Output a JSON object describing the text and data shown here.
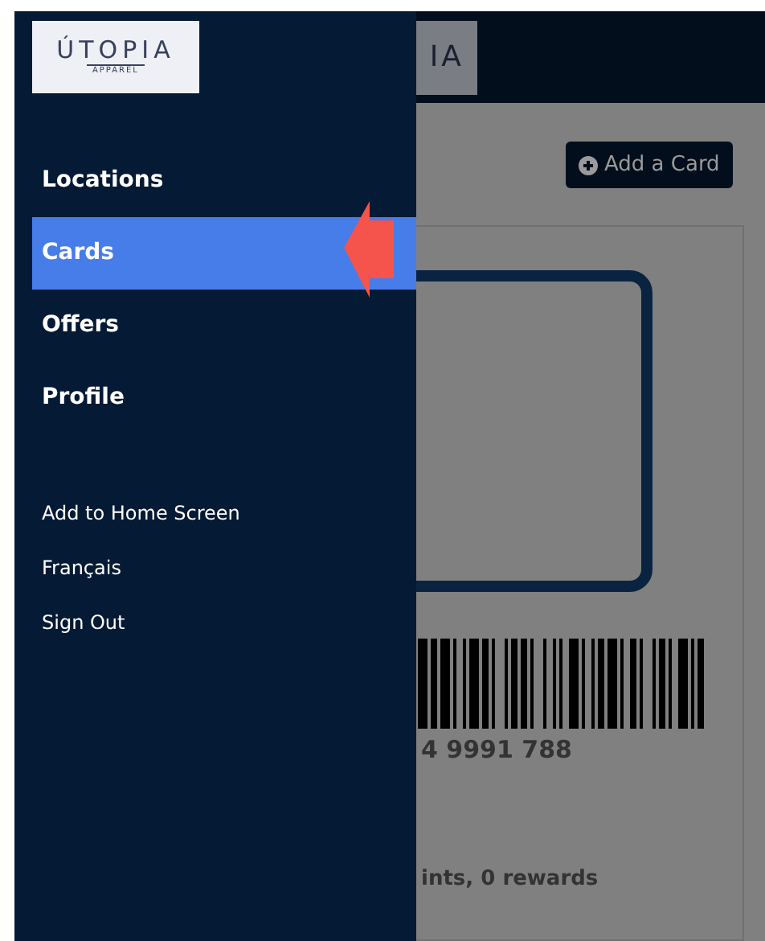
{
  "drawer": {
    "logo": {
      "name": "ÚTOPIA",
      "tagline": "APPAREL"
    },
    "primary_items": [
      {
        "label": "Locations",
        "selected": false
      },
      {
        "label": "Cards",
        "selected": true
      },
      {
        "label": "Offers",
        "selected": false
      },
      {
        "label": "Profile",
        "selected": false
      }
    ],
    "secondary_items": [
      "Add to Home Screen",
      "Français",
      "Sign Out"
    ]
  },
  "background": {
    "header_logo_text": "IA",
    "add_button": "Add a Card",
    "card_number": "4 9991 788",
    "card_summary": "ints, 0 rewards"
  }
}
